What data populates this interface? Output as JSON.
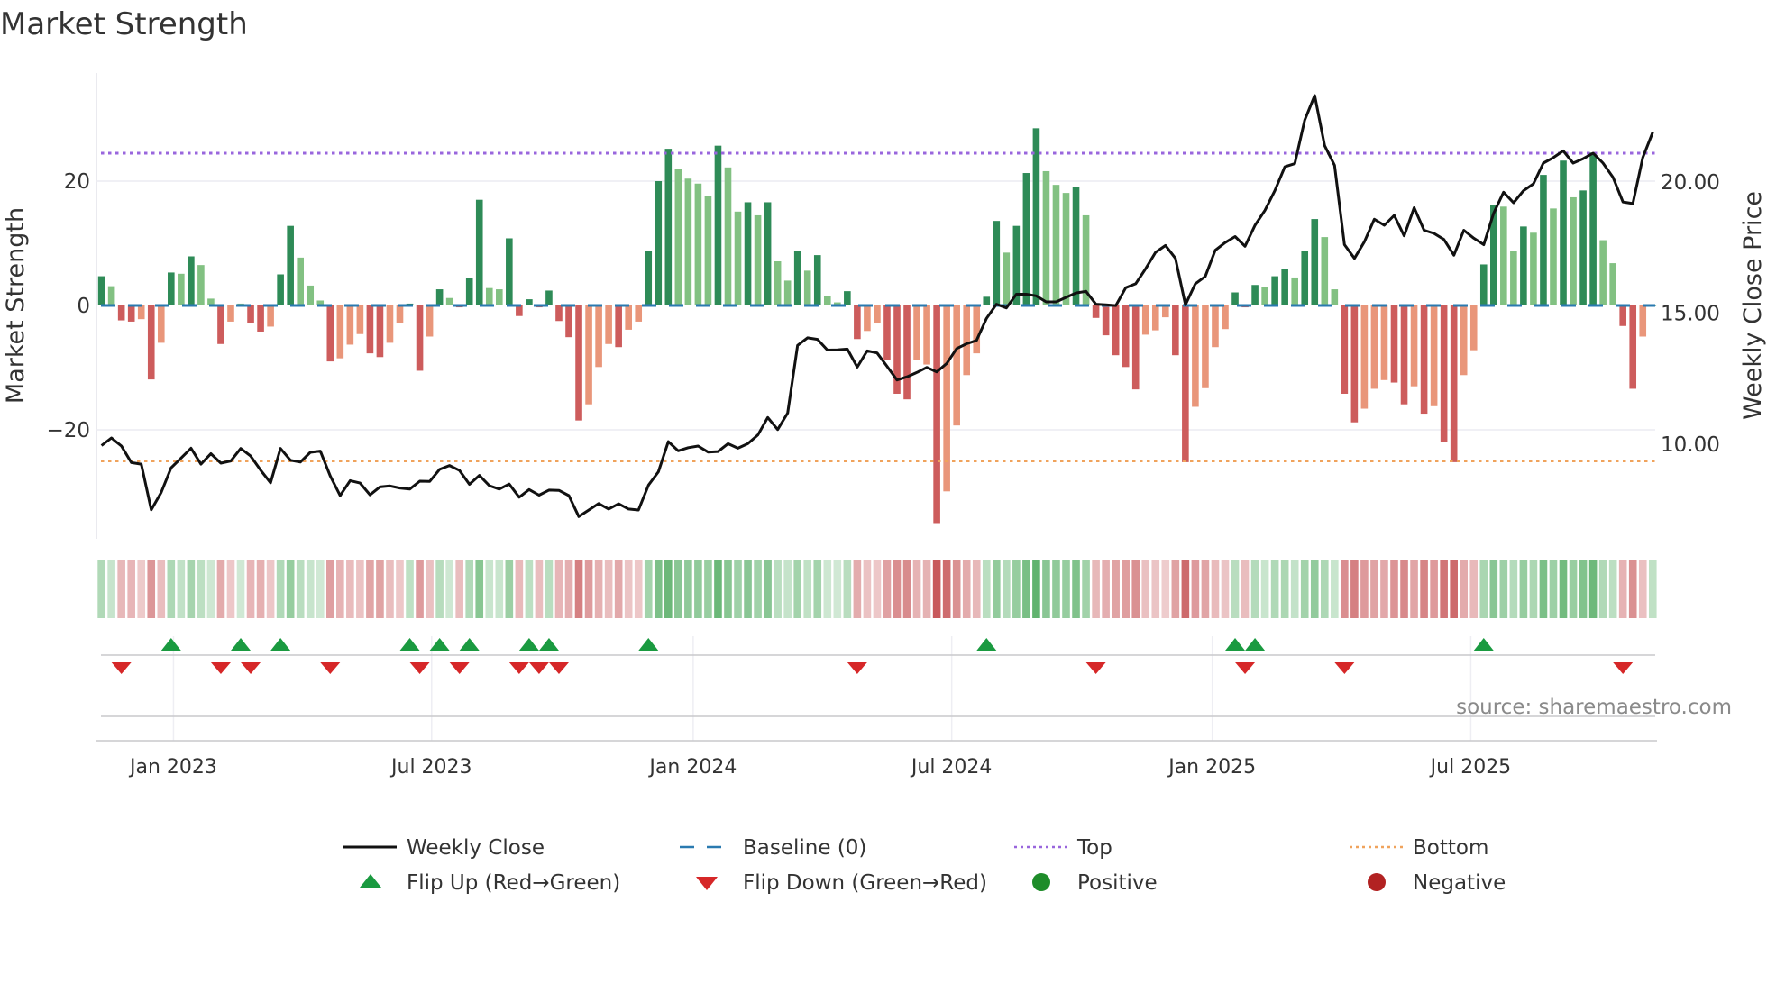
{
  "chart_data": {
    "type": "bar",
    "title": "Market Strength",
    "ylabel": "Market Strength",
    "y2label": "Weekly Close Price",
    "ylim": [
      -37,
      38
    ],
    "y2lim": [
      6.2,
      24.4
    ],
    "yticks": [
      {
        "v": 20,
        "label": "20"
      },
      {
        "v": 0,
        "label": "0"
      },
      {
        "v": -20,
        "label": "−20"
      }
    ],
    "y2ticks": [
      {
        "v": 20,
        "label": "20.00"
      },
      {
        "v": 15,
        "label": "15.00"
      },
      {
        "v": 10,
        "label": "10.00"
      }
    ],
    "xticks": [
      {
        "week": 7.24,
        "label": "Jan 2023"
      },
      {
        "week": 33.2,
        "label": "Jul 2023"
      },
      {
        "week": 59.5,
        "label": "Jan 2024"
      },
      {
        "week": 85.5,
        "label": "Jul 2024"
      },
      {
        "week": 111.7,
        "label": "Jan 2025"
      },
      {
        "week": 137.7,
        "label": "Jul 2025"
      }
    ],
    "top_level": 24.5,
    "bottom_level": -25,
    "baseline": 0,
    "strength": [
      4.7,
      3.1,
      -2.4,
      -2.6,
      -2.2,
      -11.9,
      -6,
      5.3,
      5.1,
      7.9,
      6.5,
      1.1,
      -6.2,
      -2.6,
      0.3,
      -2.9,
      -4.2,
      -3.4,
      5,
      12.8,
      7.7,
      3.2,
      0.8,
      -9,
      -8.5,
      -6.3,
      -4.6,
      -7.7,
      -8.3,
      -6,
      -2.9,
      0.3,
      -10.5,
      -5,
      2.6,
      1.2,
      -0.3,
      4.4,
      17,
      2.8,
      2.6,
      10.8,
      -1.7,
      1,
      -0.3,
      2.4,
      -2.5,
      -5.1,
      -18.5,
      -15.9,
      -9.9,
      -6.2,
      -6.7,
      -3.9,
      -2.6,
      8.7,
      20,
      25.2,
      21.9,
      20.4,
      19.6,
      17.6,
      25.7,
      22.2,
      15.1,
      16.6,
      14.5,
      16.6,
      7.1,
      4,
      8.8,
      5.6,
      8.1,
      1.5,
      0.5,
      2.3,
      -5.4,
      -4.1,
      -2.9,
      -8.8,
      -14.2,
      -15.1,
      -8.8,
      -9.5,
      -35,
      -29.9,
      -19.3,
      -11.2,
      -7.7,
      1.4,
      13.6,
      8.5,
      12.8,
      21.3,
      28.5,
      21.6,
      19.4,
      18.1,
      19,
      14.5,
      -2,
      -4.8,
      -8,
      -9.9,
      -13.5,
      -4.7,
      -4,
      -1.9,
      -8,
      -25.2,
      -16.3,
      -13.3,
      -6.7,
      -3.8,
      2.1,
      -0.3,
      3.3,
      2.9,
      4.7,
      5.8,
      4.5,
      8.8,
      13.9,
      11,
      2.6,
      -14.2,
      -18.8,
      -16.6,
      -13.4,
      -12,
      -12.4,
      -15.9,
      -13,
      -17.4,
      -16.2,
      -21.9,
      -25.2,
      -11.2,
      -7.2,
      6.6,
      16.2,
      15.9,
      8.8,
      12.7,
      11.7,
      21,
      15.6,
      23.3,
      17.4,
      18.5,
      24.6,
      10.5,
      6.8,
      -3.3,
      -13.4,
      -5,
      0
    ],
    "strong": [
      1,
      0,
      1,
      1,
      0,
      1,
      0,
      1,
      0,
      1,
      0,
      0,
      1,
      0,
      0,
      1,
      1,
      0,
      1,
      1,
      0,
      0,
      0,
      1,
      0,
      0,
      0,
      1,
      1,
      0,
      0,
      1,
      1,
      0,
      1,
      0,
      1,
      1,
      1,
      0,
      0,
      1,
      1,
      1,
      1,
      1,
      1,
      1,
      1,
      0,
      0,
      0,
      1,
      0,
      0,
      1,
      1,
      1,
      0,
      0,
      0,
      0,
      1,
      0,
      0,
      1,
      0,
      1,
      0,
      0,
      1,
      0,
      1,
      0,
      0,
      1,
      1,
      0,
      0,
      1,
      1,
      1,
      0,
      0,
      1,
      0,
      0,
      0,
      0,
      1,
      1,
      0,
      1,
      1,
      1,
      0,
      0,
      0,
      1,
      0,
      1,
      1,
      1,
      1,
      1,
      0,
      0,
      0,
      1,
      1,
      0,
      0,
      0,
      0,
      1,
      1,
      1,
      0,
      1,
      1,
      0,
      1,
      1,
      0,
      0,
      1,
      1,
      0,
      0,
      0,
      1,
      1,
      0,
      1,
      0,
      1,
      1,
      0,
      0,
      1,
      1,
      0,
      0,
      1,
      0,
      1,
      0,
      1,
      0,
      1,
      1,
      0,
      0,
      1,
      1,
      0,
      1
    ],
    "weekly_close": [
      9.95,
      10.24,
      9.93,
      9.3,
      9.24,
      7.5,
      8.16,
      9.1,
      9.47,
      9.85,
      9.24,
      9.64,
      9.28,
      9.36,
      9.84,
      9.55,
      9.01,
      8.53,
      9.84,
      9.39,
      9.32,
      9.69,
      9.74,
      8.79,
      8.04,
      8.61,
      8.52,
      8.07,
      8.37,
      8.41,
      8.33,
      8.29,
      8.59,
      8.58,
      9.04,
      9.19,
      9,
      8.47,
      8.81,
      8.42,
      8.29,
      8.48,
      7.98,
      8.27,
      8.06,
      8.25,
      8.24,
      8.04,
      7.24,
      7.49,
      7.74,
      7.53,
      7.73,
      7.53,
      7.49,
      8.44,
      8.95,
      10.1,
      9.75,
      9.87,
      9.93,
      9.7,
      9.72,
      10.02,
      9.85,
      10.02,
      10.35,
      11.02,
      10.56,
      11.19,
      13.77,
      14.06,
      14,
      13.59,
      13.6,
      13.63,
      12.94,
      13.56,
      13.48,
      12.97,
      12.45,
      12.57,
      12.74,
      12.93,
      12.76,
      13.08,
      13.65,
      13.83,
      13.96,
      14.8,
      15.34,
      15.2,
      15.72,
      15.72,
      15.66,
      15.43,
      15.43,
      15.6,
      15.77,
      15.83,
      15.34,
      15.32,
      15.29,
      15.97,
      16.12,
      16.69,
      17.32,
      17.58,
      17.09,
      15.32,
      16.12,
      16.4,
      17.4,
      17.69,
      17.92,
      17.55,
      18.35,
      18.92,
      19.67,
      20.58,
      20.7,
      22.36,
      23.3,
      21.39,
      20.64,
      17.61,
      17.09,
      17.72,
      18.58,
      18.35,
      18.73,
      17.95,
      19.02,
      18.16,
      18.04,
      17.81,
      17.21,
      18.16,
      17.86,
      17.61,
      18.81,
      19.61,
      19.21,
      19.67,
      19.93,
      20.72,
      20.93,
      21.19,
      20.72,
      20.89,
      21.1,
      20.72,
      20.18,
      19.24,
      19.18,
      20.93,
      21.9
    ],
    "flip_up_weeks": [
      7,
      14,
      18,
      31,
      34,
      37,
      43,
      45,
      55,
      89,
      114,
      116,
      139
    ],
    "flip_down_weeks": [
      2,
      12,
      15,
      23,
      32,
      36,
      42,
      44,
      46,
      76,
      100,
      115,
      125,
      153
    ],
    "legend": [
      {
        "label": "Weekly Close",
        "symbol": "line"
      },
      {
        "label": "Baseline (0)",
        "symbol": "dash"
      },
      {
        "label": "Top",
        "symbol": "dot-purple"
      },
      {
        "label": "Bottom",
        "symbol": "dot-orange"
      },
      {
        "label": "Flip Up (Red→Green)",
        "symbol": "triangle-up"
      },
      {
        "label": "Flip Down (Green→Red)",
        "symbol": "triangle-down"
      },
      {
        "label": "Positive",
        "symbol": "circle-green"
      },
      {
        "label": "Negative",
        "symbol": "circle-red"
      }
    ],
    "legend_position": "bottom",
    "annotation": "source: sharemaestro.com",
    "colors": {
      "strong_pos": "#2e8b57",
      "weak_pos": "#82c182",
      "strong_neg": "#cd5c5c",
      "weak_neg": "#e9967a",
      "top": "#9966dd",
      "bottom": "#f0a35c",
      "baseline": "#2a7ab0",
      "close": "#111111",
      "flip_up": "#1a9a40",
      "flip_down": "#d62728",
      "positive": "#1e8c2a",
      "negative": "#b22222"
    }
  }
}
